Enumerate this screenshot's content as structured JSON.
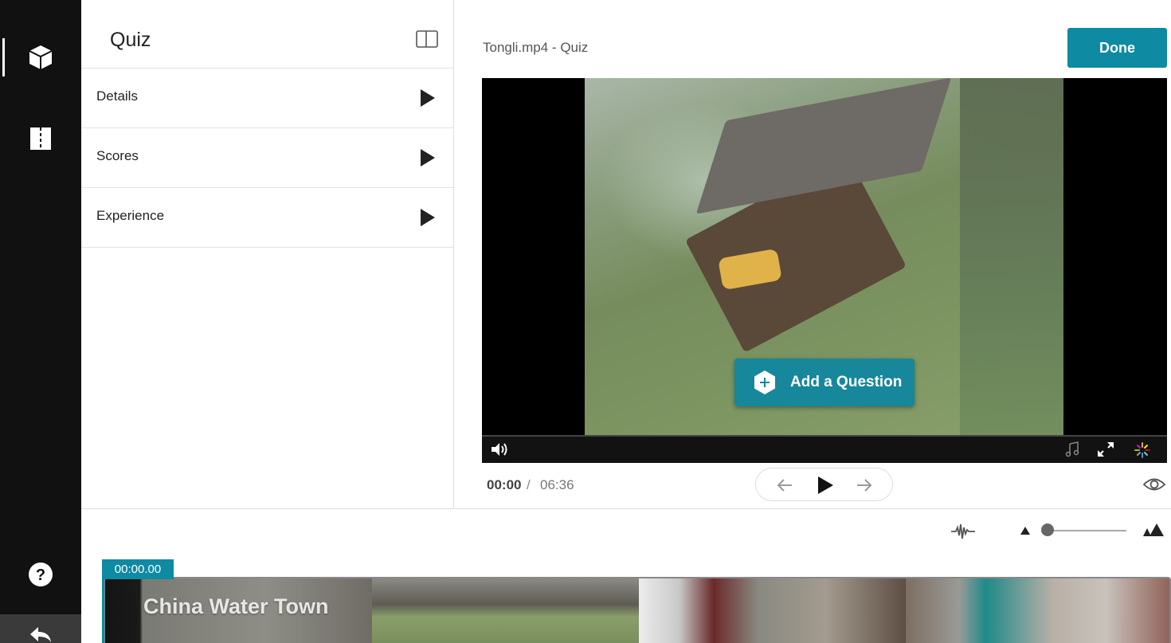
{
  "app": {
    "panel_title": "Quiz",
    "file_title": "Tongli.mp4 - Quiz",
    "done_label": "Done"
  },
  "sidebar": {
    "items": [
      {
        "name": "quiz-tool",
        "icon": "cube-icon",
        "active": true
      },
      {
        "name": "chapters-tool",
        "icon": "book-split-icon",
        "active": false
      },
      {
        "name": "help",
        "icon": "help-icon",
        "active": false
      },
      {
        "name": "back",
        "icon": "undo-arrow-icon",
        "active": false
      }
    ]
  },
  "settings": {
    "sections": [
      {
        "label": "Details"
      },
      {
        "label": "Scores"
      },
      {
        "label": "Experience"
      }
    ]
  },
  "player": {
    "add_question_label": "Add a Question",
    "current_time": "00:00",
    "separator": "/",
    "total_time": "06:36",
    "progress": 0
  },
  "timeline": {
    "marker_time": "00:00.00",
    "strip_title": "China Water Town",
    "zoom_level": 0
  },
  "colors": {
    "accent": "#0e8aa2",
    "rail": "#111111",
    "add_question": "#17879c"
  }
}
